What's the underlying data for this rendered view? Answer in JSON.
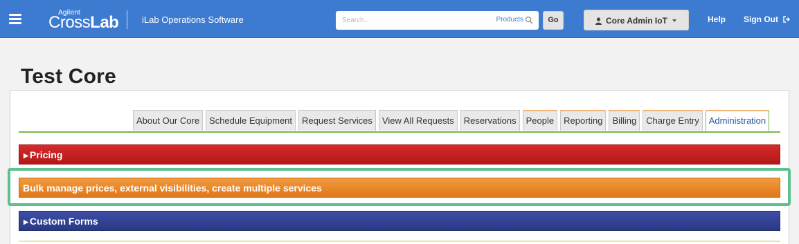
{
  "header": {
    "logo_small": "Agilent",
    "logo_cross": "Cross",
    "logo_lab": "Lab",
    "app_name": "iLab Operations Software",
    "search": {
      "placeholder": "Search..",
      "scope_label": "Products"
    },
    "go_label": "Go",
    "user_label": "Core Admin IoT",
    "help_label": "Help",
    "signout_label": "Sign Out",
    "brand_color": "#3d7bd1"
  },
  "page": {
    "title": "Test Core"
  },
  "tabs": [
    {
      "label": "About Our Core"
    },
    {
      "label": "Schedule Equipment"
    },
    {
      "label": "Request Services"
    },
    {
      "label": "View All Requests"
    },
    {
      "label": "Reservations"
    },
    {
      "label": "People"
    },
    {
      "label": "Reporting"
    },
    {
      "label": "Billing"
    },
    {
      "label": "Charge Entry"
    },
    {
      "label": "Administration",
      "active": true
    }
  ],
  "sections": {
    "pricing": {
      "label": "Pricing",
      "color": "#c62020"
    },
    "bulk": {
      "label": "Bulk manage prices, external visibilities, create multiple services",
      "color": "#ea8a2c"
    },
    "custom_forms": {
      "label": "Custom Forms",
      "color": "#33429a"
    }
  },
  "highlight_color": "#5cc08f",
  "icons": [
    "hamburger-icon",
    "search-icon",
    "user-icon",
    "caret-down-icon",
    "sign-out-icon",
    "triangle-right-icon"
  ]
}
